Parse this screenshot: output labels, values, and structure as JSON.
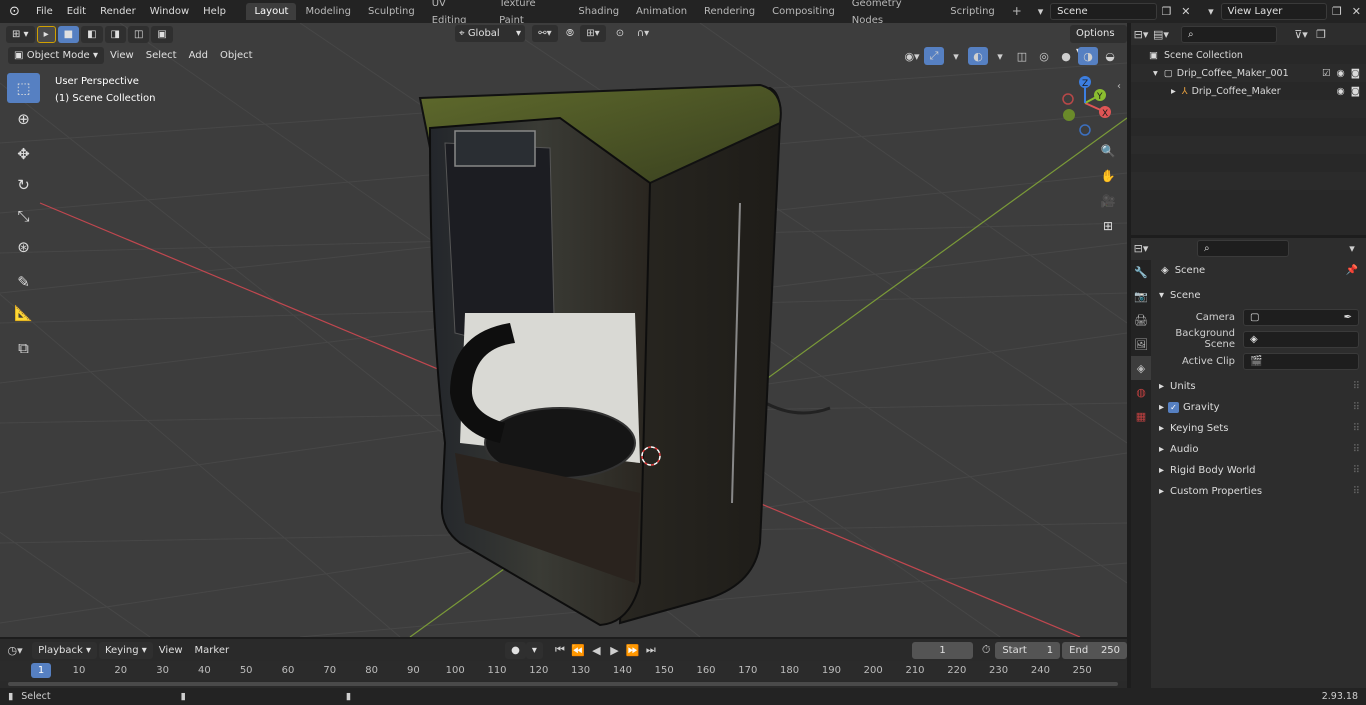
{
  "menus": [
    "File",
    "Edit",
    "Render",
    "Window",
    "Help"
  ],
  "workspaces": [
    "Layout",
    "Modeling",
    "Sculpting",
    "UV Editing",
    "Texture Paint",
    "Shading",
    "Animation",
    "Rendering",
    "Compositing",
    "Geometry Nodes",
    "Scripting"
  ],
  "active_workspace": "Layout",
  "scene_field": "Scene",
  "view_layer_field": "View Layer",
  "viewport": {
    "mode": "Object Mode",
    "menus": [
      "View",
      "Select",
      "Add",
      "Object"
    ],
    "transform_orientation": "Global",
    "options_label": "Options",
    "info_line1": "User Perspective",
    "info_line2": "(1) Scene Collection",
    "gizmo_axes": {
      "x": "X",
      "y": "Y",
      "z": "Z"
    },
    "colors": {
      "bg": "#3d3d3d",
      "x_axis": "#c0474f",
      "y_axis": "#7a9a38",
      "accent": "#5680c2"
    }
  },
  "outliner": {
    "root": "Scene Collection",
    "collection": "Drip_Coffee_Maker_001",
    "object": "Drip_Coffee_Maker"
  },
  "properties": {
    "header": "Scene",
    "panel": "Scene",
    "fields": [
      {
        "label": "Camera",
        "value": ""
      },
      {
        "label": "Background Scene",
        "value": ""
      },
      {
        "label": "Active Clip",
        "value": ""
      }
    ],
    "subpanels": [
      "Units",
      "Gravity",
      "Keying Sets",
      "Audio",
      "Rigid Body World",
      "Custom Properties"
    ],
    "gravity_checked": true
  },
  "timeline": {
    "menus": [
      "Playback",
      "Keying",
      "View",
      "Marker"
    ],
    "current_frame": "1",
    "start_label": "Start",
    "start_value": "1",
    "end_label": "End",
    "end_value": "250",
    "ruler_current": "1",
    "ticks": [
      "10",
      "20",
      "30",
      "40",
      "50",
      "60",
      "70",
      "80",
      "90",
      "100",
      "110",
      "120",
      "130",
      "140",
      "150",
      "160",
      "170",
      "180",
      "190",
      "200",
      "210",
      "220",
      "230",
      "240",
      "250"
    ]
  },
  "status": {
    "left": "Select",
    "version": "2.93.18"
  }
}
